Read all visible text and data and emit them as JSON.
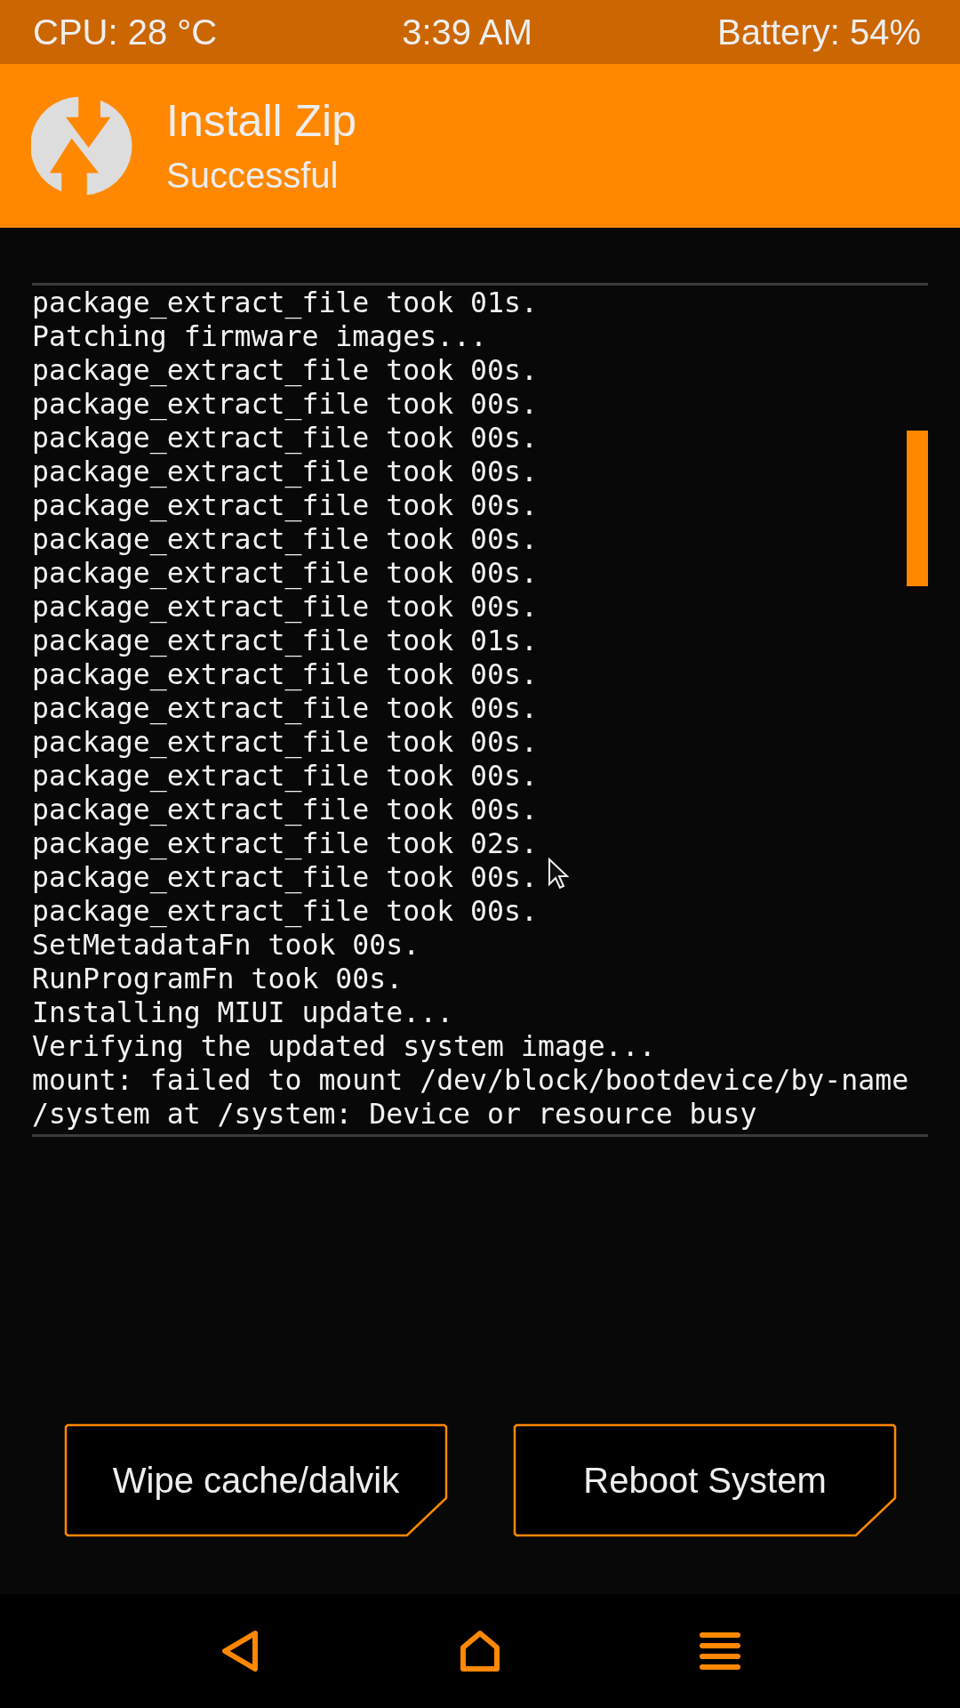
{
  "status_bar": {
    "cpu": "CPU: 28 °C",
    "time": "3:39 AM",
    "battery": "Battery: 54%"
  },
  "header": {
    "title": "Install Zip",
    "subtitle": "Successful"
  },
  "console": {
    "lines": [
      "package_extract_file took 01s.",
      "Patching firmware images...",
      "package_extract_file took 00s.",
      "package_extract_file took 00s.",
      "package_extract_file took 00s.",
      "package_extract_file took 00s.",
      "package_extract_file took 00s.",
      "package_extract_file took 00s.",
      "package_extract_file took 00s.",
      "package_extract_file took 00s.",
      "package_extract_file took 01s.",
      "package_extract_file took 00s.",
      "package_extract_file took 00s.",
      "package_extract_file took 00s.",
      "package_extract_file took 00s.",
      "package_extract_file took 00s.",
      "package_extract_file took 02s.",
      "package_extract_file took 00s.",
      "package_extract_file took 00s.",
      "SetMetadataFn took 00s.",
      "RunProgramFn took 00s.",
      "Installing MIUI update...",
      "Verifying the updated system image...",
      "mount: failed to mount /dev/block/bootdevice/by-name",
      "/system at /system: Device or resource busy"
    ]
  },
  "buttons": [
    {
      "label": "Wipe cache/dalvik"
    },
    {
      "label": "Reboot System"
    }
  ]
}
